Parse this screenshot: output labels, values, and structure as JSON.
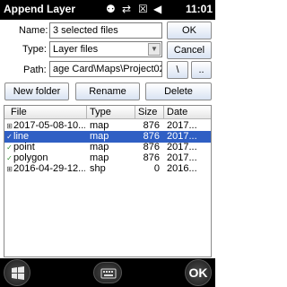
{
  "titlebar": {
    "title": "Append Layer",
    "clock": "11:01",
    "icons": [
      "gps-icon",
      "sync-arrows-icon",
      "close-signal-icon",
      "volume-icon"
    ]
  },
  "form": {
    "name_label": "Name:",
    "name_value": "3 selected files",
    "ok_label": "OK",
    "type_label": "Type:",
    "type_value": "Layer files",
    "cancel_label": "Cancel",
    "path_label": "Path:",
    "path_value": "age Card\\Maps\\Project02",
    "backslash_label": "\\",
    "up_label": ".."
  },
  "toolbar": {
    "new_folder_label": "New folder",
    "rename_label": "Rename",
    "delete_label": "Delete"
  },
  "file_list": {
    "columns": [
      "File",
      "Type",
      "Size",
      "Date"
    ],
    "rows": [
      {
        "icon": "folder-icon",
        "file": "2017-05-08-10...",
        "type": "map",
        "size": "876",
        "date": "2017...",
        "selected": false
      },
      {
        "icon": "check-icon",
        "file": "line",
        "type": "map",
        "size": "876",
        "date": "2017...",
        "selected": true
      },
      {
        "icon": "check-icon",
        "file": "point",
        "type": "map",
        "size": "876",
        "date": "2017...",
        "selected": false
      },
      {
        "icon": "check-icon",
        "file": "polygon",
        "type": "map",
        "size": "876",
        "date": "2017...",
        "selected": false
      },
      {
        "icon": "folder-icon",
        "file": "2016-04-29-12...",
        "type": "shp",
        "size": "0",
        "date": "2016...",
        "selected": false
      }
    ]
  },
  "taskbar": {
    "ok_label": "OK"
  },
  "colors": {
    "selection": "#2f5fc4",
    "titlebar": "#000000",
    "check": "#2e8b2e"
  }
}
